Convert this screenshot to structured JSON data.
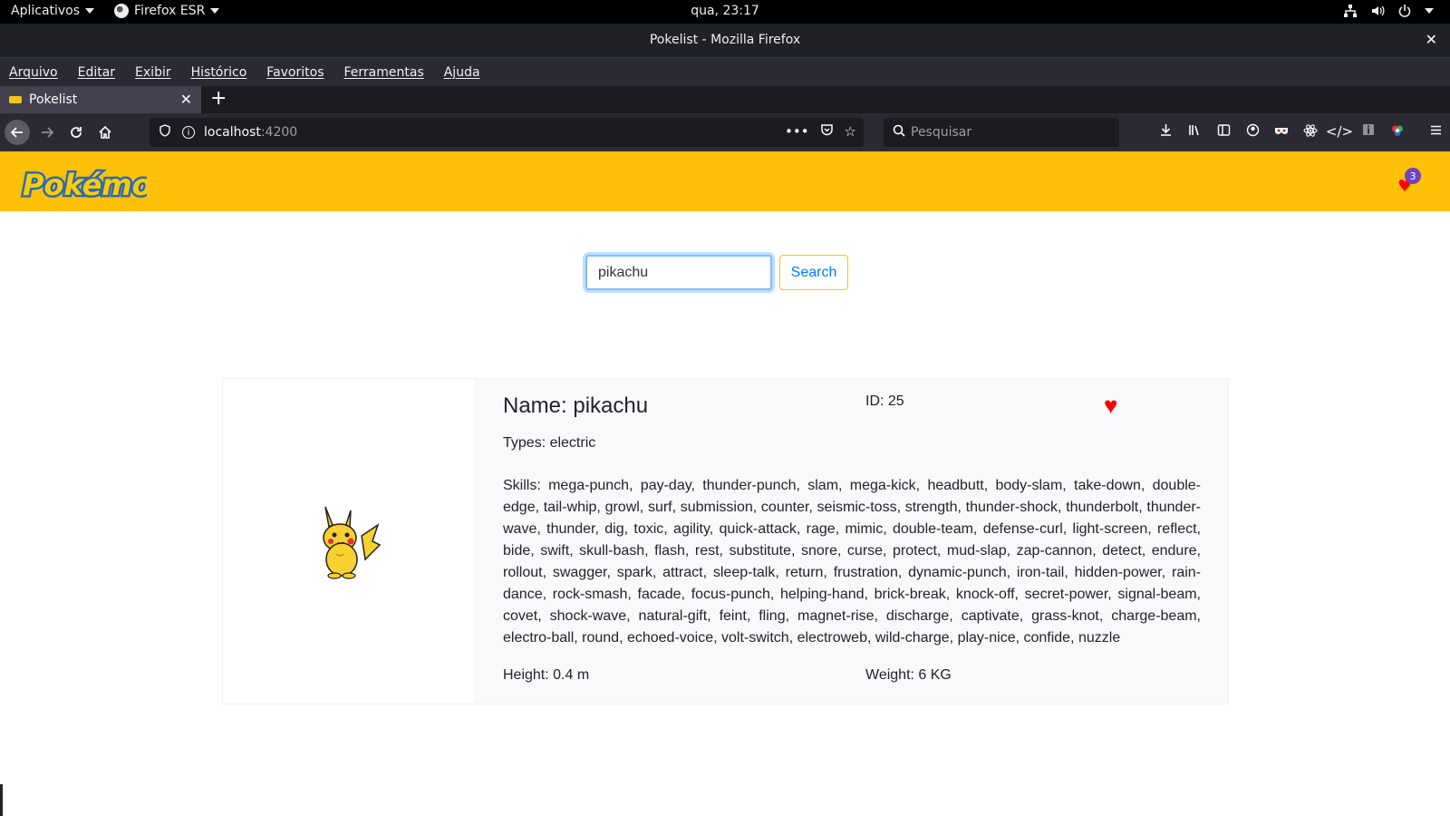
{
  "system_bar": {
    "apps_menu": "Aplicativos",
    "active_app": "Firefox ESR",
    "clock": "qua, 23:17"
  },
  "window": {
    "title": "Pokelist - Mozilla Firefox"
  },
  "menu": {
    "items": [
      "Arquivo",
      "Editar",
      "Exibir",
      "Histórico",
      "Favoritos",
      "Ferramentas",
      "Ajuda"
    ]
  },
  "tabs": [
    {
      "label": "Pokelist"
    }
  ],
  "urlbar": {
    "host": "localhost",
    "port": ":4200"
  },
  "searchbar": {
    "placeholder": "Pesquisar"
  },
  "app": {
    "logo_text": "Pokémon",
    "favorites_count": "3",
    "brand_color": "#ffc107",
    "heart_color": "#ff0000",
    "search": {
      "value": "pikachu",
      "button_label": "Search"
    },
    "pokemon": {
      "name_label": "Name: pikachu",
      "id_label": "ID: 25",
      "types_label": "Types: electric",
      "skills_label": "Skills: mega-punch, pay-day, thunder-punch, slam, mega-kick, headbutt, body-slam, take-down, double-edge, tail-whip, growl, surf, submission, counter, seismic-toss, strength, thunder-shock, thunderbolt, thunder-wave, thunder, dig, toxic, agility, quick-attack, rage, mimic, double-team, defense-curl, light-screen, reflect, bide, swift, skull-bash, flash, rest, substitute, snore, curse, protect, mud-slap, zap-cannon, detect, endure, rollout, swagger, spark, attract, sleep-talk, return, frustration, dynamic-punch, iron-tail, hidden-power, rain-dance, rock-smash, facade, focus-punch, helping-hand, brick-break, knock-off, secret-power, signal-beam, covet, shock-wave, natural-gift, feint, fling, magnet-rise, discharge, captivate, grass-knot, charge-beam, electro-ball, round, echoed-voice, volt-switch, electroweb, wild-charge, play-nice, confide, nuzzle",
      "height_label": "Height: 0.4 m",
      "weight_label": "Weight: 6 KG"
    }
  }
}
